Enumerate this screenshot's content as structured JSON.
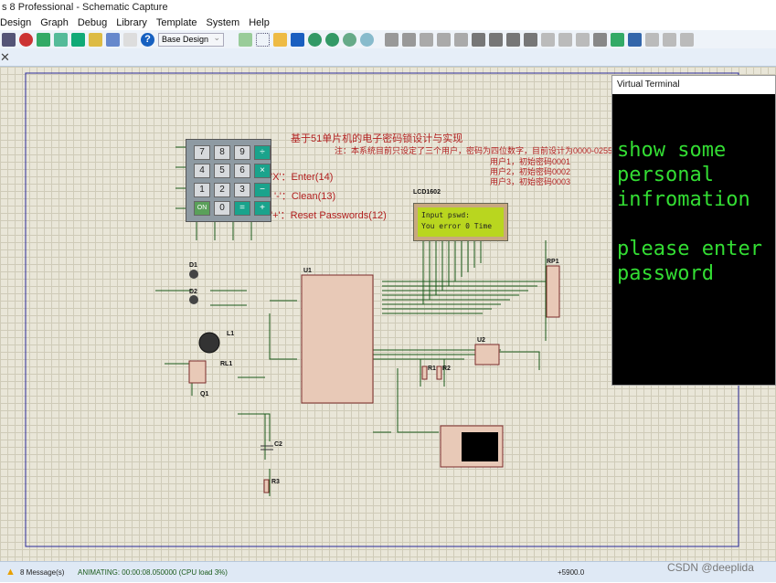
{
  "window": {
    "title": "s 8 Professional - Schematic Capture"
  },
  "menu": [
    "Design",
    "Graph",
    "Debug",
    "Library",
    "Template",
    "System",
    "Help"
  ],
  "toolbar": {
    "variant": "Base Design"
  },
  "schematic": {
    "title": "基于51单片机的电子密码锁设计与实现",
    "note": "注：本系统目前只设定了三个用户，密码为四位数字，目前设计为0000-0255",
    "users": [
      "用户1，初始密码0001",
      "用户2，初始密码0002",
      "用户3，初始密码0003"
    ],
    "key_help": [
      "'X'：Enter(14)",
      "'-'：Clean(13)",
      "'+'：Reset Passwords(12)"
    ],
    "keypad": [
      "7",
      "8",
      "9",
      "÷",
      "4",
      "5",
      "6",
      "×",
      "1",
      "2",
      "3",
      "−",
      "ON",
      "0",
      "=",
      "+"
    ],
    "lcd": {
      "name": "LCD1602",
      "line1": "Input pswd:",
      "line2": "You error 0 Time"
    },
    "parts": [
      "D1",
      "D2",
      "L1",
      "RL1",
      "Q1",
      "C2",
      "R3",
      "U1",
      "R1",
      "R2",
      "U2",
      "RP1"
    ]
  },
  "terminal": {
    "title": "Virtual Terminal",
    "text": "show some\npersonal\ninfromation\n\nplease enter\npassword"
  },
  "status": {
    "messages": "8 Message(s)",
    "animating": "ANIMATING: 00:00:08.050000 (CPU load 3%)",
    "coord": "+5900.0",
    "watermark": "CSDN @deeplida"
  }
}
